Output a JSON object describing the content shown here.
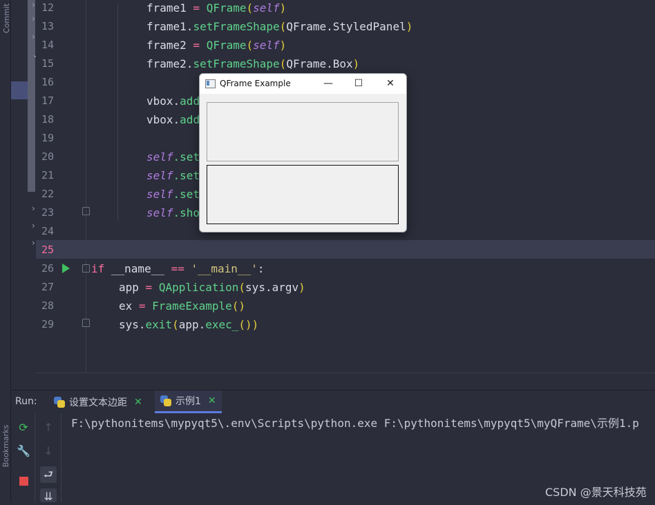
{
  "sidebar": {
    "commit_label": "Commit",
    "bookmarks_label": "Bookmarks"
  },
  "editor": {
    "line_numbers": [
      "12",
      "13",
      "14",
      "15",
      "16",
      "17",
      "18",
      "19",
      "20",
      "21",
      "22",
      "23",
      "24",
      "25",
      "26",
      "27",
      "28",
      "29"
    ],
    "current_line": "25"
  },
  "code_tokens": {
    "l12": [
      "frame1",
      " = ",
      "QFrame",
      "(",
      "self",
      ")"
    ],
    "l13": [
      "frame1.",
      "setFrameShape",
      "(",
      "QFrame.StyledPanel",
      ")"
    ],
    "l14": [
      "frame2",
      " = ",
      "QFrame",
      "(",
      "self",
      ")"
    ],
    "l15": [
      "frame2.",
      "setFrameShape",
      "(",
      "QFrame.Box",
      ")"
    ],
    "l17": [
      "vbox.",
      "add"
    ],
    "l18": [
      "vbox.",
      "add"
    ],
    "l20": [
      "self",
      ".set"
    ],
    "l21": [
      "self",
      ".set"
    ],
    "l22": [
      "self",
      ".set"
    ],
    "l23": [
      "self",
      ".sho"
    ],
    "l26": [
      "if",
      " __name__ ",
      "==",
      " ",
      "'__main__'",
      ":"
    ],
    "l27": [
      "app",
      " = ",
      "QApplication",
      "(",
      "sys.argv",
      ")"
    ],
    "l28": [
      "ex",
      " = ",
      "FrameExample",
      "()"
    ],
    "l29": [
      "sys.",
      "exit",
      "(",
      "app.",
      "exec_",
      "()",
      ")"
    ]
  },
  "run_panel": {
    "label": "Run:",
    "tabs": [
      {
        "label": "设置文本边距",
        "active": false
      },
      {
        "label": "示例1",
        "active": true
      }
    ],
    "console_line": "F:\\pythonitems\\mypyqt5\\.env\\Scripts\\python.exe F:\\pythonitems\\mypyqt5\\myQFrame\\示例1.p"
  },
  "qt_window": {
    "title": "QFrame Example",
    "minimize": "—",
    "maximize": "☐",
    "close": "✕"
  },
  "watermark": "CSDN @景天科技苑",
  "colors": {
    "keyword": "#f86e9c",
    "function": "#5fd38b",
    "self": "#b07de0",
    "string": "#d3c67e",
    "run_green": "#3fbf5f",
    "stop_red": "#e34b4b"
  }
}
